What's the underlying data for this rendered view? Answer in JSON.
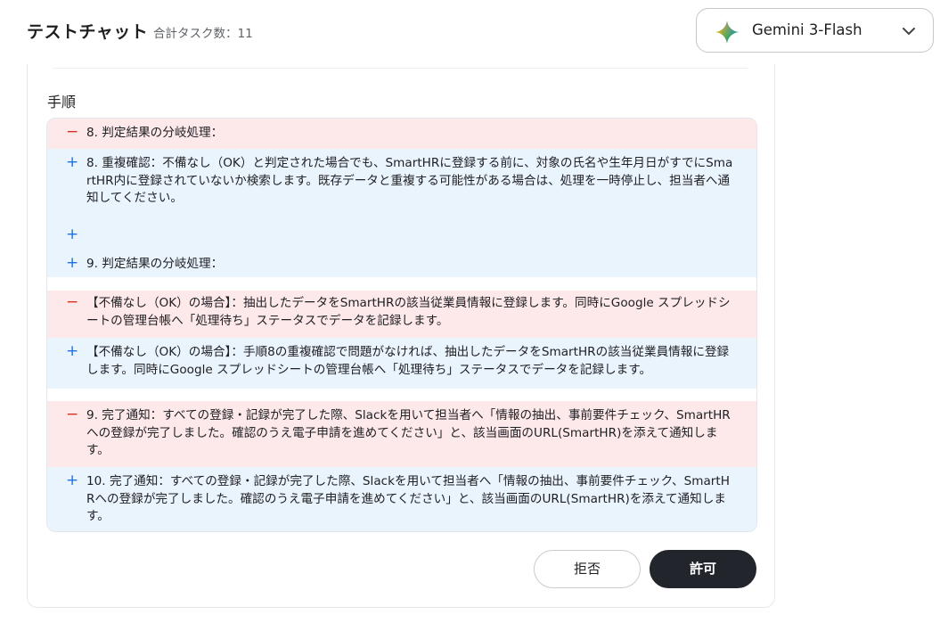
{
  "header": {
    "title": "テストチャット",
    "task_count": "合計タスク数：11"
  },
  "model_selector": {
    "label": "Gemini 3-Flash",
    "icon": "gemini-sparkle-icon"
  },
  "section": {
    "label": "手順"
  },
  "diff": {
    "lines": [
      {
        "type": "del",
        "sign": "−",
        "text": "8. 判定結果の分岐処理："
      },
      {
        "type": "add",
        "sign": "+",
        "text": "8. 重複確認：不備なし（OK）と判定された場合でも、SmartHRに登録する前に、対象の氏名や生年月日がすでにSmartHR内に登録されていないか検索します。既存データと重複する可能性がある場合は、処理を一時停止し、担当者へ通知してください。"
      },
      {
        "type": "add",
        "sign": "+",
        "text": ""
      },
      {
        "type": "add",
        "sign": "+",
        "text": "9. 判定結果の分岐処理："
      },
      {
        "type": "del",
        "sign": "−",
        "text": "【不備なし（OK）の場合】：抽出したデータをSmartHRの該当従業員情報に登録します。同時にGoogle スプレッドシートの管理台帳へ「処理待ち」ステータスでデータを記録します。"
      },
      {
        "type": "add",
        "sign": "+",
        "text": "【不備なし（OK）の場合】：手順8の重複確認で問題がなければ、抽出したデータをSmartHRの該当従業員情報に登録します。同時にGoogle スプレッドシートの管理台帳へ「処理待ち」ステータスでデータを記録します。"
      },
      {
        "type": "del",
        "sign": "−",
        "text": "9. 完了通知：すべての登録・記録が完了した際、Slackを用いて担当者へ「情報の抽出、事前要件チェック、SmartHRへの登録が完了しました。確認のうえ電子申請を進めてください」と、該当画面のURL(SmartHR)を添えて通知します。"
      },
      {
        "type": "add",
        "sign": "+",
        "text": "10. 完了通知：すべての登録・記録が完了した際、Slackを用いて担当者へ「情報の抽出、事前要件チェック、SmartHRへの登録が完了しました。確認のうえ電子申請を進めてください」と、該当画面のURL(SmartHR)を添えて通知します。"
      }
    ]
  },
  "actions": {
    "reject_label": "拒否",
    "allow_label": "許可"
  },
  "colors": {
    "deleted_bg": "#fde8ea",
    "added_bg": "#eaf4fd",
    "deleted_sign": "#d93025",
    "added_sign": "#1a73e8",
    "primary_button": "#22252b"
  }
}
